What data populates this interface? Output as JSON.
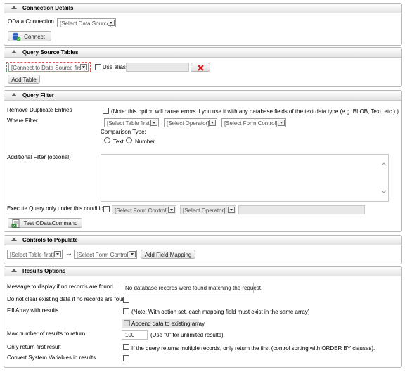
{
  "connection": {
    "title": "Connection Details",
    "odata_label": "OData Connection",
    "data_source": "[Select Data Source]",
    "connect_label": "Connect"
  },
  "source_tables": {
    "title": "Query Source Tables",
    "table_select": "[Connect to Data Source first]",
    "use_alias_label": "Use alias",
    "add_table_label": "Add Table"
  },
  "filter": {
    "title": "Query Filter",
    "remove_dup_label": "Remove Duplicate Entries",
    "remove_dup_note": "(Note: this option will cause errors if you use it with any database fields of the text data type (e.g. BLOB, Text, etc.).)",
    "where_label": "Where Filter",
    "where_table": "[Select Table first]",
    "where_operator": "[Select Operator]",
    "where_form_control": "[Select Form Control]",
    "comparison_label": "Comparison Type:",
    "radio_text": "Text",
    "radio_number": "Number",
    "additional_label": "Additional Filter (optional)",
    "exec_label": "Execute Query only under this condition",
    "exec_form_control": "[Select Form Control]",
    "exec_operator": "[Select Operator]",
    "test_label": "Test ODataCommand"
  },
  "controls": {
    "title": "Controls to Populate",
    "table_select": "[Select Table first]",
    "arrow": "→",
    "form_control": "[Select Form Control]",
    "add_mapping_label": "Add Field Mapping"
  },
  "results": {
    "title": "Results Options",
    "no_records_label": "Message to display if no records are found",
    "no_records_value": "No database records were found matching the request.",
    "dont_clear_label": "Do not clear existing data if no records are found",
    "fill_array_label": "Fill Array with results",
    "fill_array_note": "(Note: With option set, each mapping field must exist in the same array)",
    "append_label": "Append data to existing array",
    "max_label": "Max number of results to return",
    "max_value": "100",
    "max_note": "(Use \"0\" for unlimited results)",
    "first_only_label": "Only return first result",
    "first_only_note": "If the query returns multiple records, only return the first (control sorting with ORDER BY clauses).",
    "convert_label": "Convert System Variables in results"
  }
}
